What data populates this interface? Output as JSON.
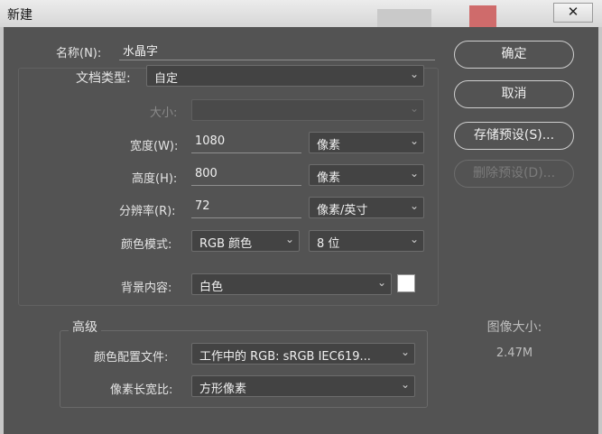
{
  "window": {
    "title": "新建",
    "close_glyph": "✕"
  },
  "form": {
    "name": {
      "label": "名称(N):",
      "value": "水晶字"
    },
    "doc_type": {
      "label": "文档类型:",
      "value": "自定"
    },
    "size": {
      "label": "大小:",
      "value": ""
    },
    "width": {
      "label": "宽度(W):",
      "value": "1080",
      "unit": "像素"
    },
    "height": {
      "label": "高度(H):",
      "value": "800",
      "unit": "像素"
    },
    "resolution": {
      "label": "分辨率(R):",
      "value": "72",
      "unit": "像素/英寸"
    },
    "color_mode": {
      "label": "颜色模式:",
      "value": "RGB 颜色",
      "depth": "8 位"
    },
    "background": {
      "label": "背景内容:",
      "value": "白色",
      "swatch_color": "#ffffff"
    }
  },
  "advanced": {
    "heading": "高级",
    "color_profile": {
      "label": "颜色配置文件:",
      "value": "工作中的 RGB: sRGB IEC619..."
    },
    "pixel_aspect": {
      "label": "像素长宽比:",
      "value": "方形像素"
    }
  },
  "buttons": {
    "ok": "确定",
    "cancel": "取消",
    "save_preset": "存储预设(S)...",
    "delete_preset": "删除预设(D)..."
  },
  "image_size": {
    "label": "图像大小:",
    "value": "2.47M"
  },
  "colors": {
    "dialog_bg": "#535353",
    "field_bg": "#434343",
    "text": "#e2e2e2"
  }
}
